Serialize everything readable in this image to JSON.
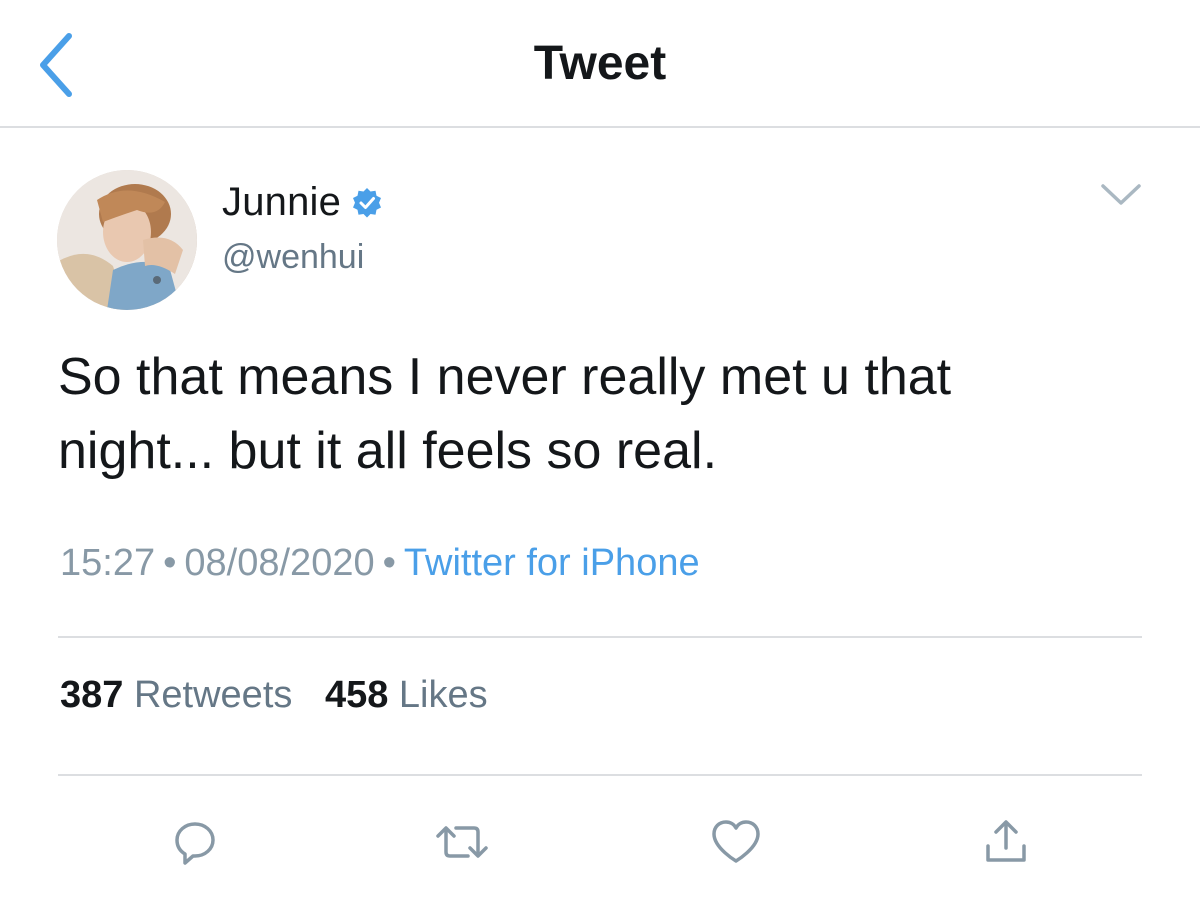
{
  "header": {
    "title": "Tweet",
    "back_icon": "chevron-left-icon",
    "accent_color": "#4a9fe8"
  },
  "author": {
    "display_name": "Junnie",
    "handle": "@wenhui",
    "verified": true,
    "verified_icon": "verified-badge-icon",
    "menu_icon": "chevron-down-icon"
  },
  "tweet": {
    "text_line1": "So that means I never really met u that",
    "text_line2": "night... but it all feels so real.",
    "time": "15:27",
    "date": "08/08/2020",
    "source": "Twitter for iPhone",
    "separator": "•"
  },
  "stats": {
    "retweets_count": "387",
    "retweets_label": "Retweets",
    "likes_count": "458",
    "likes_label": "Likes"
  },
  "actions": {
    "reply_icon": "reply-icon",
    "retweet_icon": "retweet-icon",
    "like_icon": "heart-icon",
    "share_icon": "share-icon",
    "icon_color": "#8899a6"
  }
}
